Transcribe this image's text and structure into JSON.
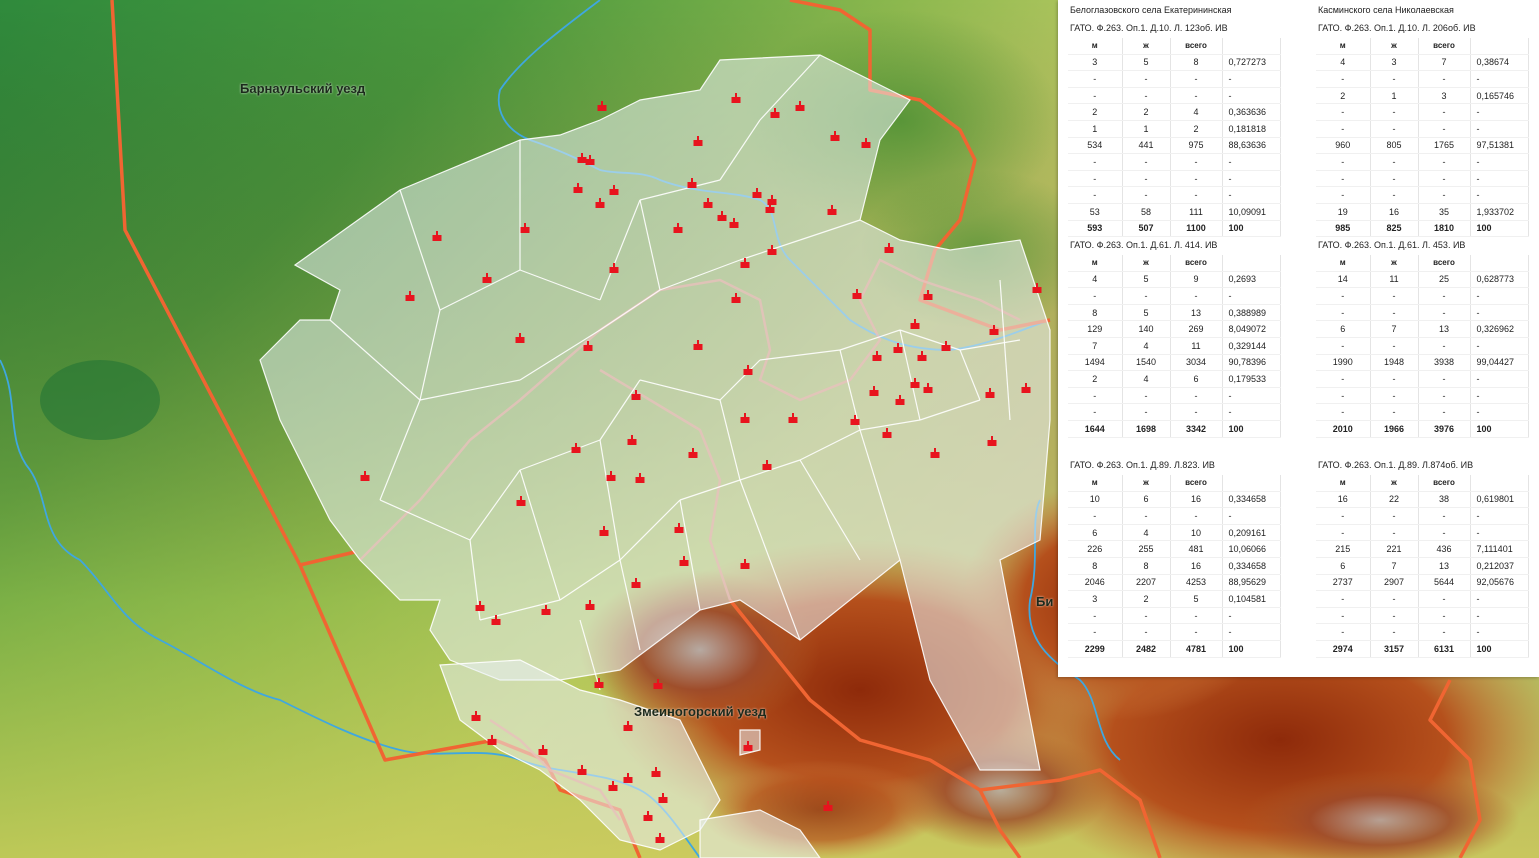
{
  "map": {
    "labels": {
      "barnaul": "Барнаульский уезд",
      "zmeinogorsk": "Змеиногорский уезд",
      "biysk_partial": "Би"
    },
    "colors": {
      "county_border": "#f06532",
      "parish_fill": "#e8eef2",
      "parish_line": "#ffffff",
      "river": "#3fa7e0",
      "church_marker": "#e8141e"
    }
  },
  "tables": [
    {
      "title": "Белоглазовского села Екатерининская",
      "archive": "ГАТО. Ф.263. Оп.1. Д.10. Л. 123об. ИВ",
      "columns": [
        "м",
        "ж",
        "всего",
        ""
      ],
      "rows": [
        [
          "3",
          "5",
          "8",
          "0,727273"
        ],
        [
          "-",
          "-",
          "-",
          "-"
        ],
        [
          "-",
          "-",
          "-",
          "-"
        ],
        [
          "2",
          "2",
          "4",
          "0,363636"
        ],
        [
          "1",
          "1",
          "2",
          "0,181818"
        ],
        [
          "534",
          "441",
          "975",
          "88,63636"
        ],
        [
          "-",
          "-",
          "-",
          "-"
        ],
        [
          "-",
          "-",
          "-",
          "-"
        ],
        [
          "-",
          "-",
          "-",
          "-"
        ],
        [
          "53",
          "58",
          "111",
          "10,09091"
        ]
      ],
      "total": [
        "593",
        "507",
        "1100",
        "100"
      ]
    },
    {
      "title": "Касминского села Николаевская",
      "archive": "ГАТО. Ф.263. Оп.1. Д.10. Л. 206об. ИВ",
      "columns": [
        "м",
        "ж",
        "всего",
        ""
      ],
      "rows": [
        [
          "4",
          "3",
          "7",
          "0,38674"
        ],
        [
          "-",
          "-",
          "-",
          "-"
        ],
        [
          "2",
          "1",
          "3",
          "0,165746"
        ],
        [
          "-",
          "-",
          "-",
          "-"
        ],
        [
          "-",
          "-",
          "-",
          "-"
        ],
        [
          "960",
          "805",
          "1765",
          "97,51381"
        ],
        [
          "-",
          "-",
          "-",
          "-"
        ],
        [
          "-",
          "-",
          "-",
          "-"
        ],
        [
          "-",
          "-",
          "-",
          "-"
        ],
        [
          "19",
          "16",
          "35",
          "1,933702"
        ]
      ],
      "total": [
        "985",
        "825",
        "1810",
        "100"
      ]
    },
    {
      "title": "",
      "archive": "ГАТО. Ф.263. Оп.1. Д.61. Л. 414. ИВ",
      "columns": [
        "м",
        "ж",
        "всего",
        ""
      ],
      "rows": [
        [
          "4",
          "5",
          "9",
          "0,2693"
        ],
        [
          "-",
          "-",
          "-",
          "-"
        ],
        [
          "8",
          "5",
          "13",
          "0,388989"
        ],
        [
          "129",
          "140",
          "269",
          "8,049072"
        ],
        [
          "7",
          "4",
          "11",
          "0,329144"
        ],
        [
          "1494",
          "1540",
          "3034",
          "90,78396"
        ],
        [
          "2",
          "4",
          "6",
          "0,179533"
        ],
        [
          "-",
          "-",
          "-",
          "-"
        ],
        [
          "-",
          "-",
          "-",
          "-"
        ]
      ],
      "total": [
        "1644",
        "1698",
        "3342",
        "100"
      ]
    },
    {
      "title": "",
      "archive": "ГАТО. Ф.263. Оп.1. Д.61. Л. 453. ИВ",
      "columns": [
        "м",
        "ж",
        "всего",
        ""
      ],
      "rows": [
        [
          "14",
          "11",
          "25",
          "0,628773"
        ],
        [
          "-",
          "-",
          "-",
          "-"
        ],
        [
          "-",
          "-",
          "-",
          "-"
        ],
        [
          "6",
          "7",
          "13",
          "0,326962"
        ],
        [
          "-",
          "-",
          "-",
          "-"
        ],
        [
          "1990",
          "1948",
          "3938",
          "99,04427"
        ],
        [
          "-",
          "-",
          "-",
          "-"
        ],
        [
          "-",
          "-",
          "-",
          "-"
        ],
        [
          "-",
          "-",
          "-",
          "-"
        ]
      ],
      "total": [
        "2010",
        "1966",
        "3976",
        "100"
      ]
    },
    {
      "title": "",
      "archive": "ГАТО. Ф.263. Оп.1. Д.89. Л.823. ИВ",
      "columns": [
        "м",
        "ж",
        "всего",
        ""
      ],
      "rows": [
        [
          "10",
          "6",
          "16",
          "0,334658"
        ],
        [
          "-",
          "-",
          "-",
          "-"
        ],
        [
          "6",
          "4",
          "10",
          "0,209161"
        ],
        [
          "226",
          "255",
          "481",
          "10,06066"
        ],
        [
          "8",
          "8",
          "16",
          "0,334658"
        ],
        [
          "2046",
          "2207",
          "4253",
          "88,95629"
        ],
        [
          "3",
          "2",
          "5",
          "0,104581"
        ],
        [
          "-",
          "-",
          "-",
          "-"
        ],
        [
          "-",
          "-",
          "-",
          "-"
        ]
      ],
      "total": [
        "2299",
        "2482",
        "4781",
        "100"
      ]
    },
    {
      "title": "",
      "archive": "ГАТО. Ф.263. Оп.1. Д.89. Л.874об. ИВ",
      "columns": [
        "м",
        "ж",
        "всего",
        ""
      ],
      "rows": [
        [
          "16",
          "22",
          "38",
          "0,619801"
        ],
        [
          "-",
          "-",
          "-",
          "-"
        ],
        [
          "-",
          "-",
          "-",
          "-"
        ],
        [
          "215",
          "221",
          "436",
          "7,111401"
        ],
        [
          "6",
          "7",
          "13",
          "0,212037"
        ],
        [
          "2737",
          "2907",
          "5644",
          "92,05676"
        ],
        [
          "-",
          "-",
          "-",
          "-"
        ],
        [
          "-",
          "-",
          "-",
          "-"
        ],
        [
          "-",
          "-",
          "-",
          "-"
        ]
      ],
      "total": [
        "2974",
        "3157",
        "6131",
        "100"
      ]
    }
  ]
}
